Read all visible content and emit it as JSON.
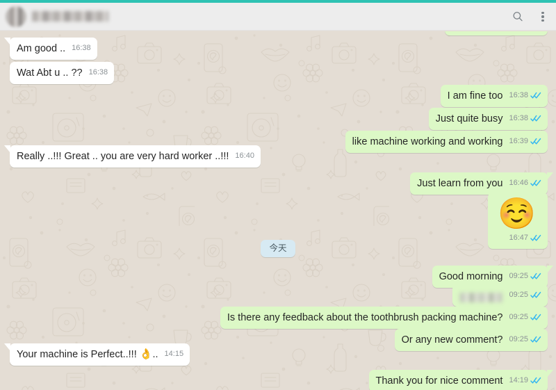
{
  "window": {
    "app_name": "WhatsApp",
    "accent_teal": "#2ec2b3",
    "header_bg": "#ededed",
    "chat_bg": "#e4ddd4",
    "bubble_in_bg": "#ffffff",
    "bubble_out_bg": "#dcf8c6",
    "tick_blue": "#34b7f1"
  },
  "header": {
    "contact_name": "",
    "contact_name_redacted": true,
    "avatar_redacted": true,
    "search_icon": "search-icon",
    "menu_icon": "overflow-menu-icon"
  },
  "date_divider": {
    "label": "今天"
  },
  "messages": [
    {
      "id": "m1",
      "direction": "in",
      "text": "Am good ..",
      "time": "16:38",
      "tail": true,
      "status": ""
    },
    {
      "id": "m2",
      "direction": "in",
      "text": "Wat Abt u .. ??",
      "time": "16:38",
      "tail": false,
      "status": ""
    },
    {
      "id": "m3",
      "direction": "out",
      "text": "I am fine too",
      "time": "16:38",
      "tail": false,
      "status": "read"
    },
    {
      "id": "m4",
      "direction": "out",
      "text": "Just quite busy",
      "time": "16:38",
      "tail": false,
      "status": "read"
    },
    {
      "id": "m5",
      "direction": "out",
      "text": "like machine working and working",
      "time": "16:39",
      "tail": false,
      "status": "read"
    },
    {
      "id": "m6",
      "direction": "in",
      "text": "Really ..!!! Great .. you are very hard worker ..!!!",
      "time": "16:40",
      "tail": true,
      "status": ""
    },
    {
      "id": "m7",
      "direction": "out",
      "text": "Just learn from you",
      "time": "16:46",
      "tail": true,
      "status": "read"
    },
    {
      "id": "m8",
      "direction": "out",
      "text": "",
      "emoji": "☺️",
      "emoji_name": "relieved-face-emoji",
      "time": "16:47",
      "tail": false,
      "status": "read"
    },
    {
      "id": "m9",
      "direction": "out",
      "text": "Good morning",
      "time": "09:25",
      "tail": true,
      "status": "read"
    },
    {
      "id": "m10",
      "direction": "out",
      "text": "",
      "redacted": true,
      "time": "09:25",
      "tail": false,
      "status": "read"
    },
    {
      "id": "m11",
      "direction": "out",
      "text": "Is there any feedback about the toothbrush packing machine?",
      "time": "09:25",
      "tail": false,
      "status": "read"
    },
    {
      "id": "m12",
      "direction": "out",
      "text": "Or any new comment?",
      "time": "09:25",
      "tail": false,
      "status": "read"
    },
    {
      "id": "m13",
      "direction": "in",
      "text": "Your machine is Perfect..!!! ",
      "emoji": "👌",
      "emoji_name": "ok-hand-emoji",
      "text_after": "..",
      "time": "14:15",
      "tail": true,
      "status": ""
    },
    {
      "id": "m14",
      "direction": "out",
      "text": "Thank you for nice comment",
      "time": "14:19",
      "tail": true,
      "status": "read"
    }
  ]
}
